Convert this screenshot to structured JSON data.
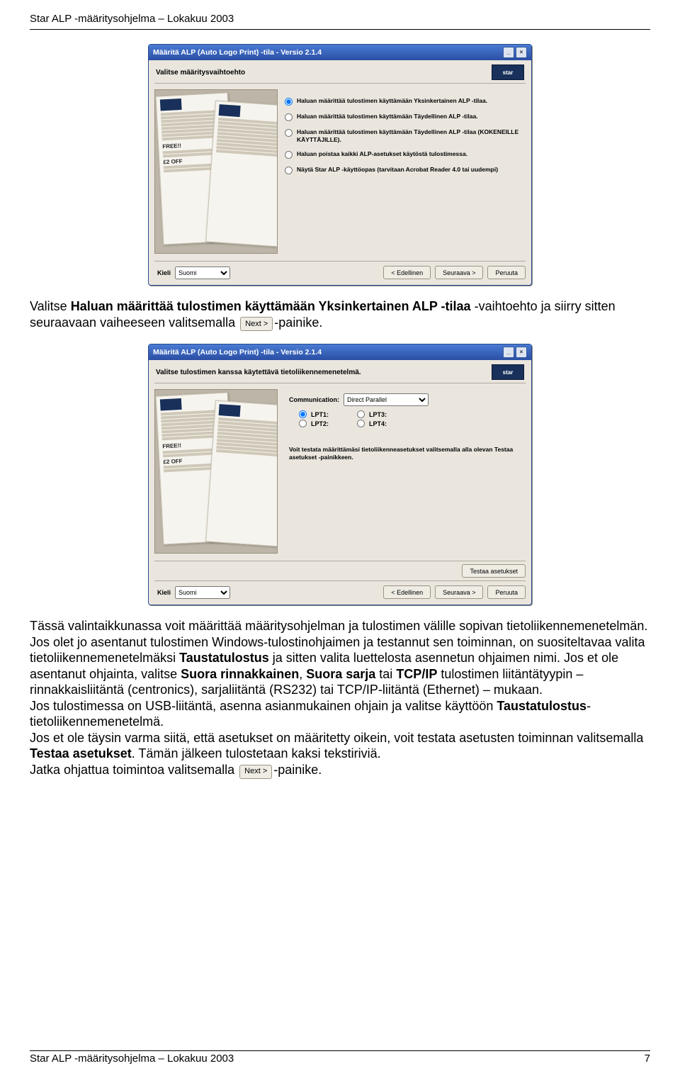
{
  "doc_header": "Star ALP -määritysohjelma – Lokakuu 2003",
  "dialog1": {
    "title": "Määritä ALP (Auto Logo Print) -tila - Versio 2.1.4",
    "subtitle": "Valitse määritysvaihtoehto",
    "brand": "star",
    "options": [
      "Haluan määrittää tulostimen käyttämään Yksinkertainen ALP -tilaa.",
      "Haluan määrittää tulostimen käyttämään Täydellinen ALP -tilaa.",
      "Haluan määrittää tulostimen käyttämään Täydellinen ALP -tilaa (KOKENEILLE KÄYTTÄJILLE).",
      "Haluan poistaa kaikki ALP-asetukset käytöstä tulostimessa.",
      "Näytä Star ALP -käyttöopas (tarvitaan Acrobat Reader 4.0 tai uudempi)"
    ],
    "kieli_label": "Kieli",
    "kieli_value": "Suomi",
    "btn_prev": "< Edellinen",
    "btn_next": "Seuraava >",
    "btn_cancel": "Peruuta"
  },
  "para1_a": "Valitse ",
  "para1_b": "Haluan määrittää tulostimen käyttämään Yksinkertainen ALP -tilaa",
  "para1_c": " -vaihtoehto ja siirry sitten seuraavaan vaiheeseen valitsemalla ",
  "para1_d": "-painike.",
  "next_btn_label": "Next >",
  "dialog2": {
    "title": "Määritä ALP (Auto Logo Print) -tila - Versio 2.1.4",
    "subtitle": "Valitse tulostimen kanssa käytettävä tietoliikennemenetelmä.",
    "brand": "star",
    "comm_label": "Communication:",
    "comm_value": "Direct Parallel",
    "lpt": [
      "LPT1:",
      "LPT2:",
      "LPT3:",
      "LPT4:"
    ],
    "test_note": "Voit testata määrittämäsi tietoliikenneasetukset valitsemalla alla olevan Testaa asetukset -painikkeen.",
    "btn_test": "Testaa asetukset",
    "kieli_label": "Kieli",
    "kieli_value": "Suomi",
    "btn_prev": "< Edellinen",
    "btn_next": "Seuraava >",
    "btn_cancel": "Peruuta"
  },
  "para2": {
    "t1": "Tässä valintaikkunassa voit määrittää määritysohjelman ja tulostimen välille sopivan tietoliikennemenetelmän. Jos olet jo asentanut tulostimen Windows-tulostinohjaimen ja testannut sen toiminnan, on suositeltavaa valita tietoliikennemenetelmäksi ",
    "b1": "Taustatulostus",
    "t2": " ja sitten valita luettelosta asennetun ohjaimen nimi. Jos et ole asentanut ohjainta, valitse ",
    "b2": "Suora rinnakkainen",
    "t3": ", ",
    "b3": "Suora sarja",
    "t4": " tai ",
    "b4": "TCP/IP",
    "t5": " tulostimen liitäntätyypin – rinnakkaisliitäntä (centronics), sarjaliitäntä (RS232) tai TCP/IP-liitäntä (Ethernet) – mukaan.",
    "t6": "Jos tulostimessa on USB-liitäntä, asenna asianmukainen ohjain ja valitse käyttöön ",
    "b5": "Taustatulostus",
    "t7": "-tietoliikennemenetelmä.",
    "t8": "Jos et ole täysin varma siitä, että asetukset on määritetty oikein, voit testata asetusten toiminnan valitsemalla ",
    "b6": "Testaa asetukset",
    "t9": ". Tämän jälkeen tulostetaan kaksi tekstiriviä.",
    "t10": "Jatka ohjattua toimintoa valitsemalla ",
    "t11": "-painike."
  },
  "footer_left": "Star ALP -määritysohjelma – Lokakuu 2003",
  "footer_right": "7"
}
